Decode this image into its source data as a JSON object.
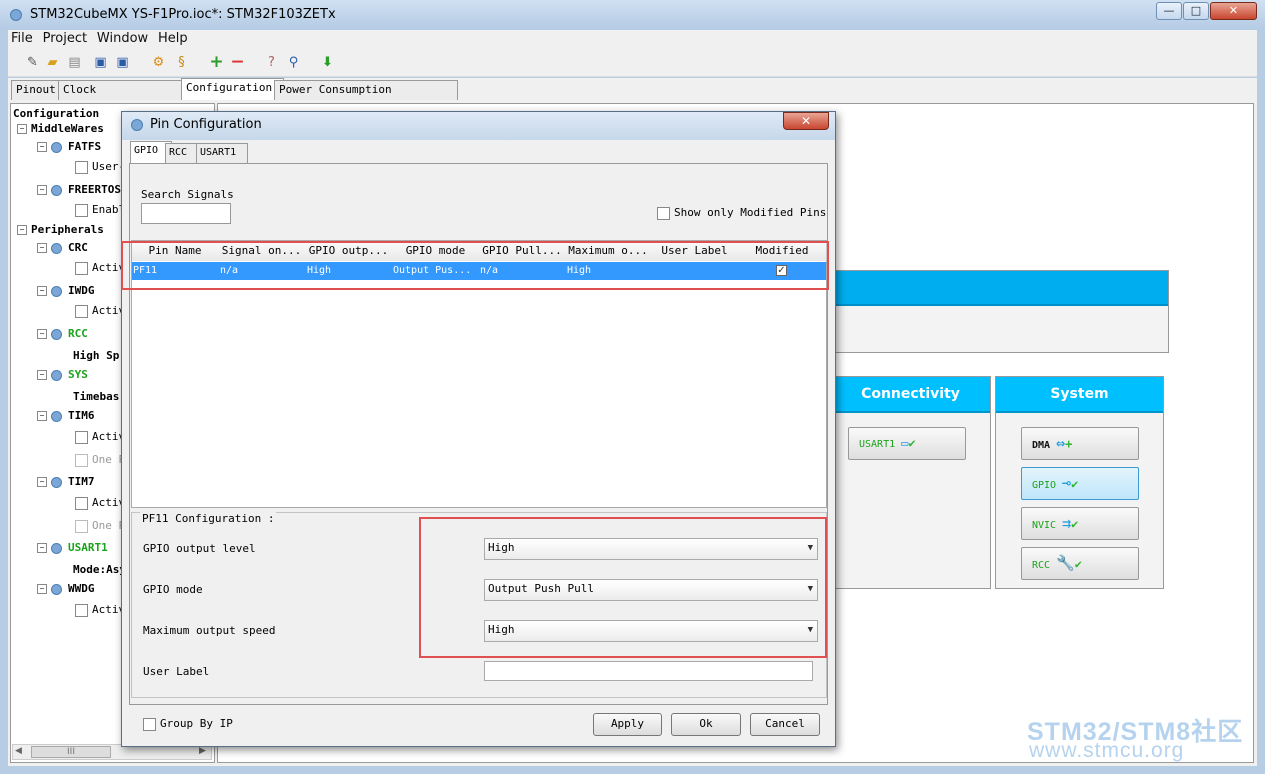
{
  "window": {
    "title": "STM32CubeMX YS-F1Pro.ioc*: STM32F103ZETx",
    "minimize": "—",
    "maximize": "□",
    "close": "✕"
  },
  "menu": [
    "File",
    "Project",
    "Window",
    "Help"
  ],
  "toolbar_icons": [
    "new-project-icon",
    "open-icon",
    "recent-icon",
    "save-icon",
    "save-as-icon",
    "generate-report-icon",
    "generate-code-icon",
    "add-icon",
    "remove-icon",
    "help-icon",
    "about-icon",
    "download-icon"
  ],
  "main_tabs": [
    "Pinout",
    "Clock Configuration",
    "Configuration",
    "Power Consumption Calculator"
  ],
  "tree": {
    "root": "Configuration",
    "middlewares": "MiddleWares",
    "fatfs": "FATFS",
    "fatfs_child": "User-",
    "freertos": "FREERTOS",
    "freertos_child": "Enabl",
    "peripherals": "Peripherals",
    "crc": "CRC",
    "crc_child": "Activ",
    "iwdg": "IWDG",
    "iwdg_child": "Activ",
    "rcc": "RCC",
    "rcc_child": "High Sp",
    "sys": "SYS",
    "sys_child": "Timebas",
    "tim6": "TIM6",
    "tim6_child1": "Activ",
    "tim6_child2": "One P",
    "tim7": "TIM7",
    "tim7_child1": "Activ",
    "tim7_child2": "One P",
    "usart1": "USART1",
    "usart1_child": "Mode:Asy",
    "wwdg": "WWDG",
    "wwdg_child": "Activ",
    "scroll_thumb": "III"
  },
  "categories": {
    "connectivity": {
      "title": "Connectivity",
      "buttons": [
        "USART1"
      ]
    },
    "system": {
      "title": "System",
      "buttons": [
        "DMA",
        "GPIO",
        "NVIC",
        "RCC"
      ]
    }
  },
  "watermark": {
    "line1": "STM32/STM8社区",
    "line2": "www.stmcu.org"
  },
  "dialog": {
    "title": "Pin Configuration",
    "close": "✕",
    "tabs": [
      "GPIO",
      "RCC",
      "USART1"
    ],
    "search_label": "Search Signals",
    "search_value": "",
    "show_modified_label": "Show only Modified Pins",
    "columns": [
      "Pin Name",
      "Signal on...",
      "GPIO outp...",
      "GPIO mode",
      "GPIO Pull...",
      "Maximum o...",
      "User Label",
      "Modified"
    ],
    "rows": [
      {
        "pin": "PF11",
        "signal": "n/a",
        "output": "High",
        "mode": "Output Pus...",
        "pull": "n/a",
        "max": "High",
        "label": "",
        "modified": true
      }
    ],
    "config_title": "PF11 Configuration :",
    "fields": {
      "output_level": {
        "label": "GPIO output level",
        "value": "High"
      },
      "mode": {
        "label": "GPIO mode",
        "value": "Output Push Pull"
      },
      "speed": {
        "label": "Maximum output speed",
        "value": "High"
      },
      "user_label": {
        "label": "User Label",
        "value": ""
      }
    },
    "group_by_ip": "Group By IP",
    "apply": "Apply",
    "ok": "Ok",
    "cancel": "Cancel"
  },
  "colors": {
    "accent": "#00bfff",
    "selection": "#3399ff",
    "highlight_box": "#e05050",
    "green_text": "#1aa31a"
  }
}
